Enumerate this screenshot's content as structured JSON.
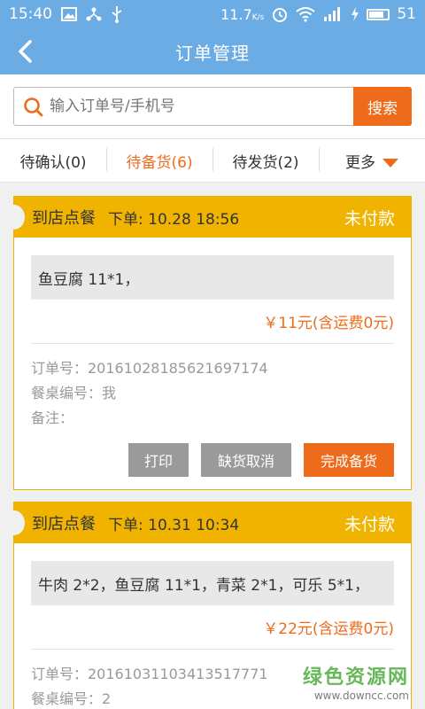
{
  "status_bar": {
    "time": "15:40",
    "speed": "11.7",
    "speed_unit": "K/s",
    "battery": "51",
    "icons": [
      "image-icon",
      "share-icon",
      "usb-icon",
      "alarm-icon",
      "wifi-icon",
      "signal-icon",
      "battery-icon"
    ]
  },
  "nav": {
    "title": "订单管理",
    "back_icon": "chevron-left-icon"
  },
  "search": {
    "placeholder": "输入订单号/手机号",
    "button_label": "搜索"
  },
  "tabs": [
    {
      "label": "待确认(0)",
      "active": false
    },
    {
      "label": "待备货(6)",
      "active": true
    },
    {
      "label": "待发货(2)",
      "active": false
    },
    {
      "label": "更多",
      "active": false
    }
  ],
  "orders": [
    {
      "type": "到店点餐",
      "time_label": "下单: 10.28 18:56",
      "pay_status": "未付款",
      "items": "鱼豆腐 11*1，",
      "price": "￥11元(含运费0元)",
      "order_no": "订单号：20161028185621697174",
      "table_no": "餐桌编号：我",
      "note": "备注：",
      "actions": [
        "打印",
        "缺货取消",
        "完成备货"
      ]
    },
    {
      "type": "到店点餐",
      "time_label": "下单: 10.31 10:34",
      "pay_status": "未付款",
      "items": "牛肉 2*2，鱼豆腐 11*1，青菜 2*1，可乐 5*1，",
      "price": "￥22元(含运费0元)",
      "order_no": "订单号：20161031103413517771",
      "table_no": "餐桌编号：2"
    }
  ],
  "watermark": {
    "line1": "绿色资源网",
    "line2": "www.downcc.com"
  },
  "colors": {
    "header": "#6cace4",
    "accent": "#ef6b1c",
    "card_head": "#f0b400"
  }
}
